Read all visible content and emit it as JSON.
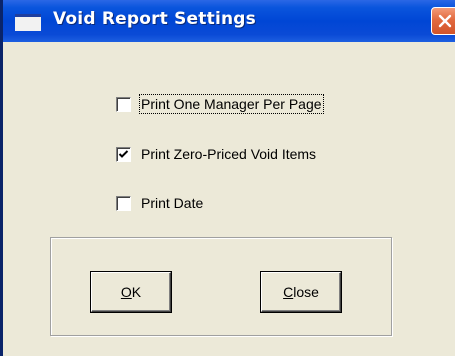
{
  "window": {
    "title": "Void Report Settings"
  },
  "options": [
    {
      "label": "Print One Manager Per Page",
      "checked": false,
      "focused": true
    },
    {
      "label": "Print Zero-Priced Void Items",
      "checked": true,
      "focused": false
    },
    {
      "label": "Print Date",
      "checked": false,
      "focused": false
    }
  ],
  "buttons": {
    "ok": {
      "mnemonic": "O",
      "rest": "K"
    },
    "close": {
      "mnemonic": "C",
      "rest": "lose"
    }
  },
  "colors": {
    "titlebar": "#0046d5",
    "close_button": "#e26a3f",
    "dialog_background": "#ece9d8"
  },
  "icons": {
    "window_icon": "window-icon",
    "close_icon": "close-icon",
    "check_icon": "checkmark-icon"
  }
}
